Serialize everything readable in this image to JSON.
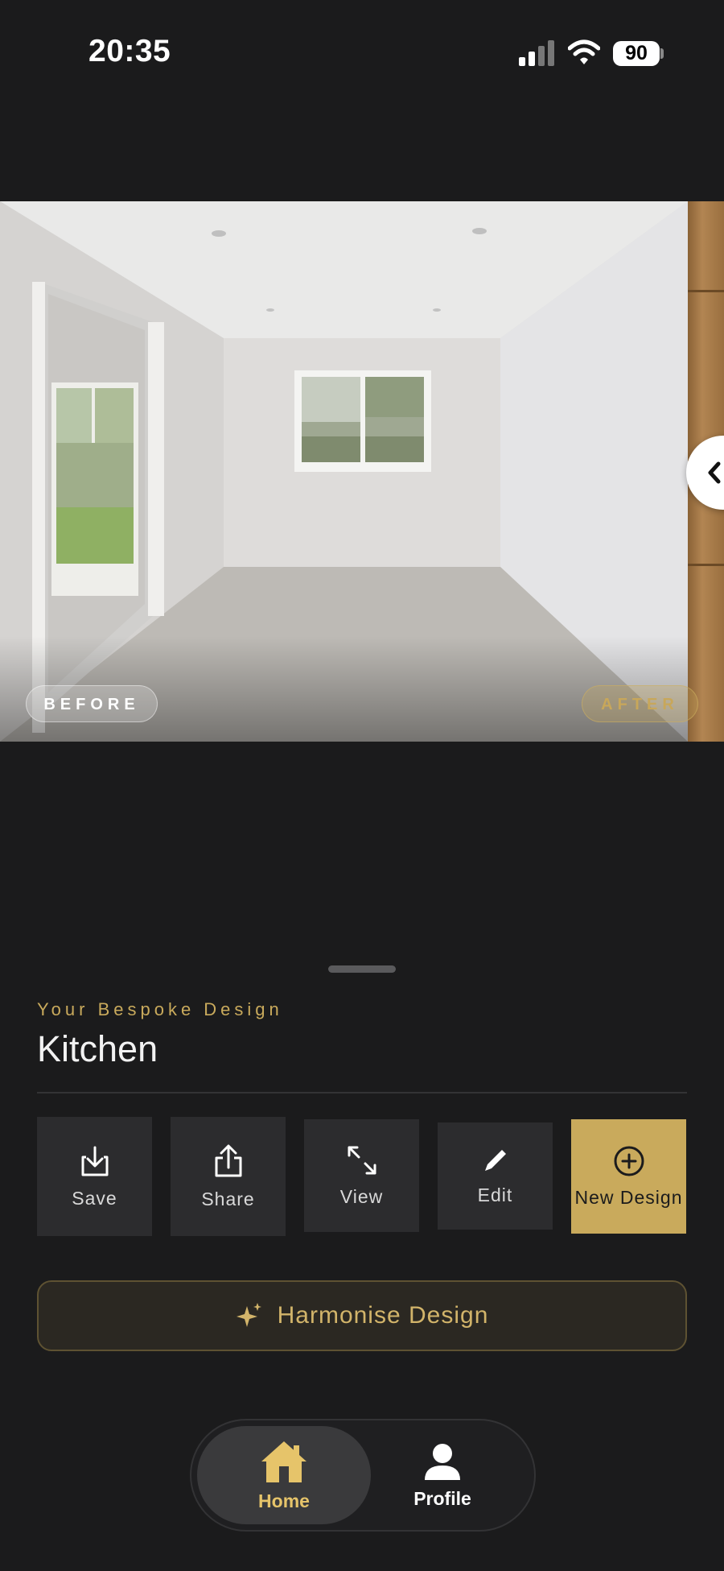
{
  "status_bar": {
    "time": "20:35",
    "battery": "90"
  },
  "compare": {
    "before_label": "BEFORE",
    "after_label": "AFTER"
  },
  "design": {
    "eyebrow": "Your Bespoke Design",
    "room": "Kitchen"
  },
  "actions": [
    {
      "label": "Save",
      "icon": "download-icon"
    },
    {
      "label": "Share",
      "icon": "share-icon"
    },
    {
      "label": "View",
      "icon": "expand-icon"
    },
    {
      "label": "Edit",
      "icon": "pencil-icon"
    },
    {
      "label": "New Design",
      "icon": "plus-circle-icon"
    }
  ],
  "harmonise": {
    "label": "Harmonise Design",
    "icon": "sparkles-icon"
  },
  "tabs": [
    {
      "label": "Home",
      "icon": "home-icon",
      "active": true
    },
    {
      "label": "Profile",
      "icon": "person-icon",
      "active": false
    }
  ],
  "colors": {
    "background": "#1b1b1c",
    "accent_gold": "#c9aa5c",
    "tile": "#2c2c2e"
  }
}
